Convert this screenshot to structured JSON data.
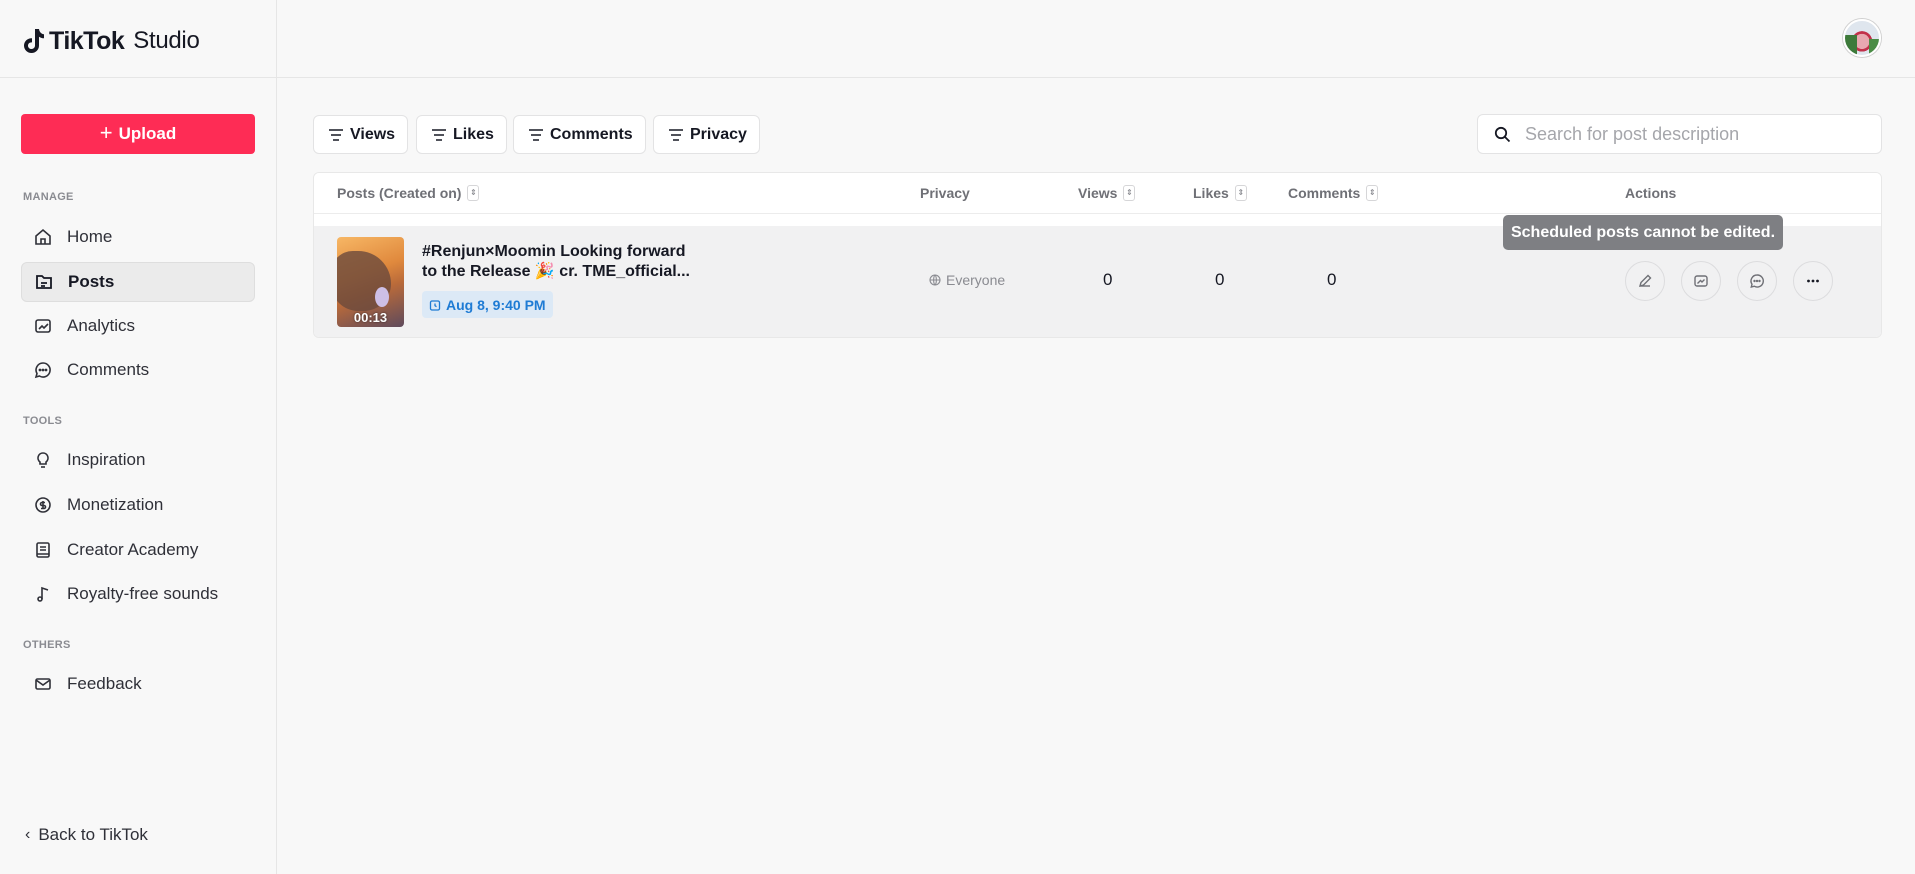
{
  "brand": {
    "name": "TikTok",
    "suffix": "Studio"
  },
  "sidebar": {
    "upload_label": "Upload",
    "sections": {
      "manage": "MANAGE",
      "tools": "TOOLS",
      "others": "OTHERS"
    },
    "items": [
      {
        "label": "Home",
        "icon": "home-icon"
      },
      {
        "label": "Posts",
        "icon": "posts-icon",
        "active": true
      },
      {
        "label": "Analytics",
        "icon": "analytics-icon"
      },
      {
        "label": "Comments",
        "icon": "comments-icon"
      },
      {
        "label": "Inspiration",
        "icon": "lightbulb-icon"
      },
      {
        "label": "Monetization",
        "icon": "dollar-icon"
      },
      {
        "label": "Creator Academy",
        "icon": "academy-icon"
      },
      {
        "label": "Royalty-free sounds",
        "icon": "music-note-icon"
      },
      {
        "label": "Feedback",
        "icon": "mail-icon"
      }
    ],
    "back_label": "Back to TikTok"
  },
  "filters": [
    "Views",
    "Likes",
    "Comments",
    "Privacy"
  ],
  "search": {
    "placeholder": "Search for post description",
    "value": ""
  },
  "table": {
    "headers": {
      "posts": "Posts (Created on)",
      "privacy": "Privacy",
      "views": "Views",
      "likes": "Likes",
      "comments": "Comments",
      "actions": "Actions"
    },
    "rows": [
      {
        "duration": "00:13",
        "description": "#Renjun×Moomin Looking forward to the Release 🎉 cr. TME_official...",
        "scheduled_date": "Aug 8, 9:40 PM",
        "privacy": "Everyone",
        "views": "0",
        "likes": "0",
        "comments": "0"
      }
    ]
  },
  "tooltip": "Scheduled posts cannot be edited.",
  "colors": {
    "accent": "#fe2c55",
    "date_badge_bg": "#dce9f6",
    "date_badge_text": "#1e7bd4",
    "tooltip_bg": "#7e7f83"
  }
}
